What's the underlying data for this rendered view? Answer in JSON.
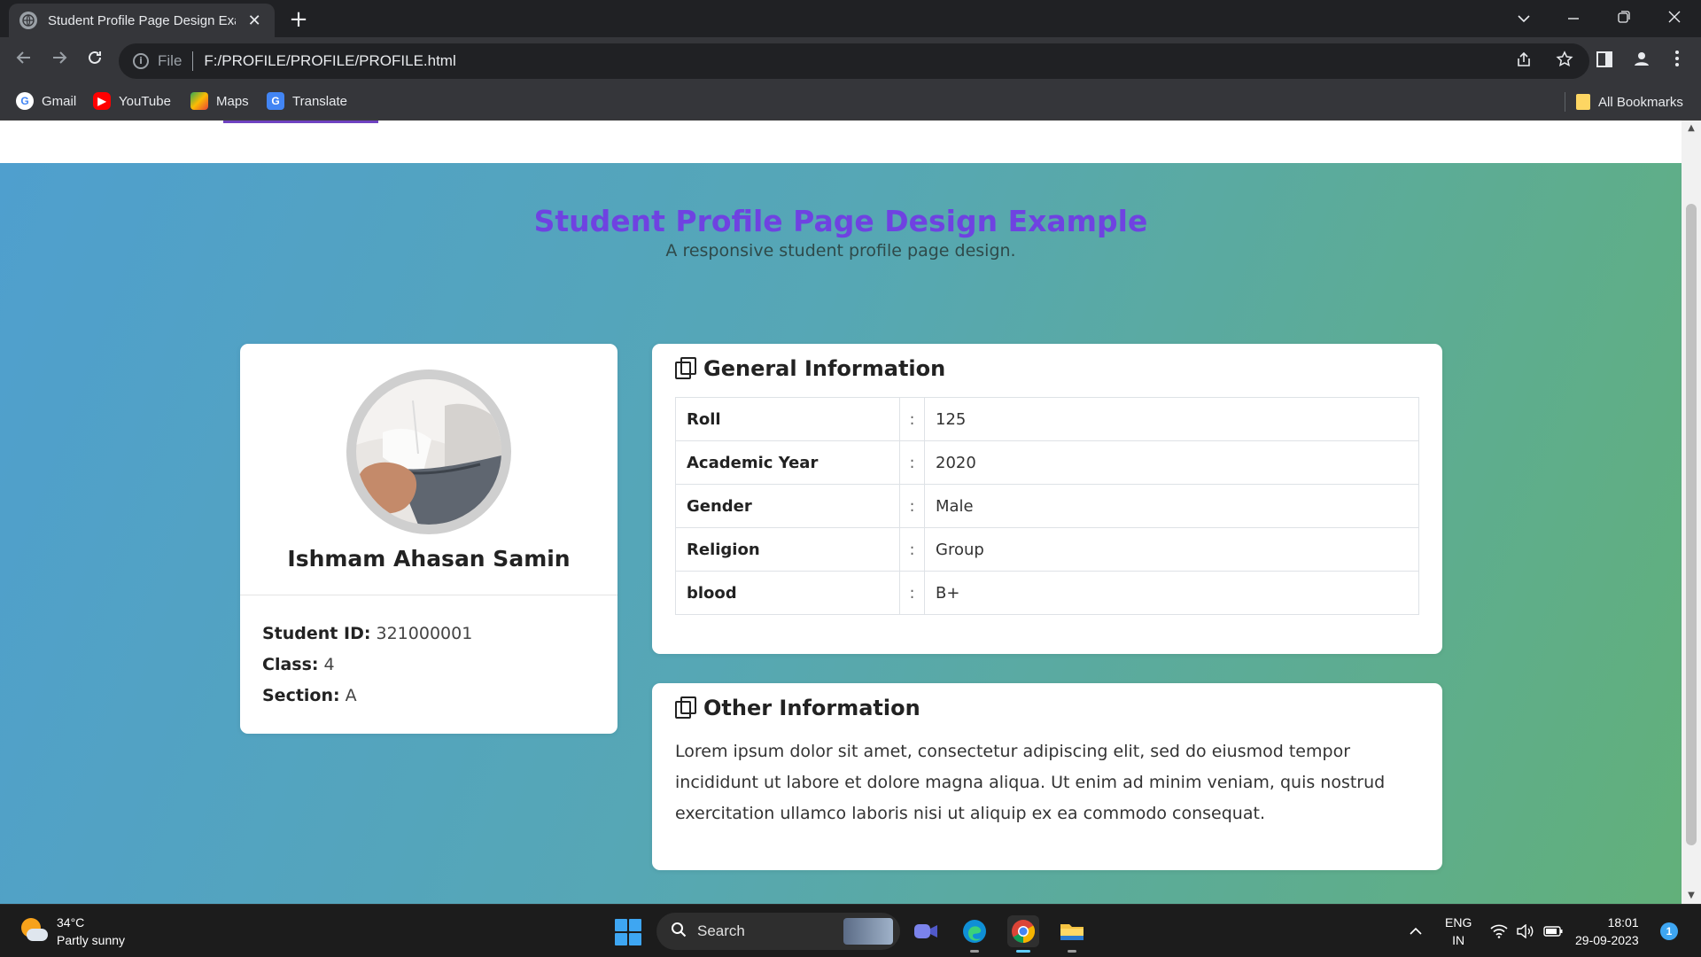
{
  "browser": {
    "tab_title": "Student Profile Page Design Exa",
    "tab_close": "✕",
    "new_tab": "+",
    "omnibox": {
      "scheme": "File",
      "url": "F:/PROFILE/PROFILE/PROFILE.html"
    },
    "bookmarks": [
      {
        "label": "Gmail",
        "icon": "google-icon"
      },
      {
        "label": "YouTube",
        "icon": "youtube-icon"
      },
      {
        "label": "Maps",
        "icon": "maps-icon"
      },
      {
        "label": "Translate",
        "icon": "translate-icon"
      }
    ],
    "all_bookmarks": "All Bookmarks",
    "colors": {
      "chrome_dark": "#202124",
      "chrome_mid": "#35363a",
      "text": "#e8eaed"
    }
  },
  "page": {
    "title": "Student Profile Page Design Example",
    "subtitle": "A responsive student profile page design.",
    "colors": {
      "title": "#6f42e1",
      "gradient_start": "#4f9fce",
      "gradient_end": "#62b07a"
    },
    "profile": {
      "name": "Ishmam Ahasan Samin",
      "student_id_label": "Student ID:",
      "student_id": "321000001",
      "class_label": "Class:",
      "class_value": "4",
      "section_label": "Section:",
      "section_value": "A"
    },
    "general_info": {
      "heading": "General Information",
      "separator": ":",
      "rows": [
        {
          "key": "Roll",
          "value": "125"
        },
        {
          "key": "Academic Year",
          "value": "2020"
        },
        {
          "key": "Gender",
          "value": "Male"
        },
        {
          "key": "Religion",
          "value": "Group"
        },
        {
          "key": "blood",
          "value": "B+"
        }
      ]
    },
    "other_info": {
      "heading": "Other Information",
      "text": "Lorem ipsum dolor sit amet, consectetur adipiscing elit, sed do eiusmod tempor incididunt ut labore et dolore magna aliqua. Ut enim ad minim veniam, quis nostrud exercitation ullamco laboris nisi ut aliquip ex ea commodo consequat."
    }
  },
  "taskbar": {
    "weather_temp": "34°C",
    "weather_desc": "Partly sunny",
    "search_placeholder": "Search",
    "lang_line1": "ENG",
    "lang_line2": "IN",
    "time": "18:01",
    "date": "29-09-2023",
    "notification_count": "1"
  }
}
